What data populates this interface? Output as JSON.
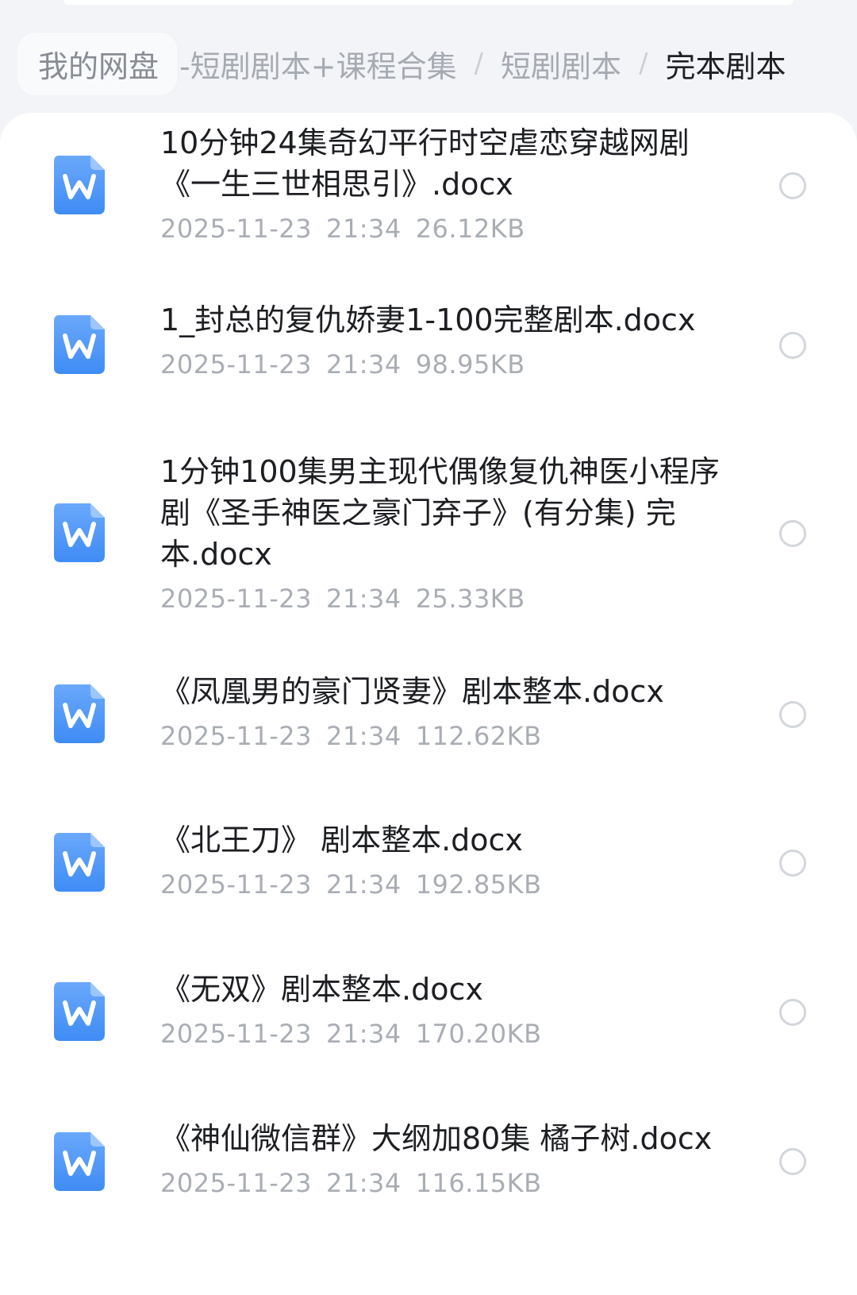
{
  "breadcrumb": {
    "root": "我的网盘",
    "parent1": "-短剧剧本+课程合集",
    "parent2": "短剧剧本",
    "current": "完本剧本",
    "separator": "/"
  },
  "files": [
    {
      "name": "10分钟24集奇幻平行时空虐恋穿越网剧《一生三世相思引》.docx",
      "date": "2025-11-23",
      "time": "21:34",
      "size": "26.12KB",
      "icon": "word-doc-icon"
    },
    {
      "name": "1_封总的复仇娇妻1-100完整剧本.docx",
      "date": "2025-11-23",
      "time": "21:34",
      "size": "98.95KB",
      "icon": "word-doc-icon"
    },
    {
      "name": "1分钟100集男主现代偶像复仇神医小程序剧《圣手神医之豪门弃子》(有分集) 完本.docx",
      "date": "2025-11-23",
      "time": "21:34",
      "size": "25.33KB",
      "icon": "word-doc-icon"
    },
    {
      "name": "《凤凰男的豪门贤妻》剧本整本.docx",
      "date": "2025-11-23",
      "time": "21:34",
      "size": "112.62KB",
      "icon": "word-doc-icon"
    },
    {
      "name": "《北王刀》 剧本整本.docx",
      "date": "2025-11-23",
      "time": "21:34",
      "size": "192.85KB",
      "icon": "word-doc-icon"
    },
    {
      "name": "《无双》剧本整本.docx",
      "date": "2025-11-23",
      "time": "21:34",
      "size": "170.20KB",
      "icon": "word-doc-icon"
    },
    {
      "name": "《神仙微信群》大纲加80集 橘子树.docx",
      "date": "2025-11-23",
      "time": "21:34",
      "size": "116.15KB",
      "icon": "word-doc-icon"
    }
  ],
  "colors": {
    "icon_blue": "#3f8cf5",
    "icon_blue_light": "#6aa8fb",
    "text_primary": "#1c1e22",
    "text_secondary": "#a9adb4"
  }
}
